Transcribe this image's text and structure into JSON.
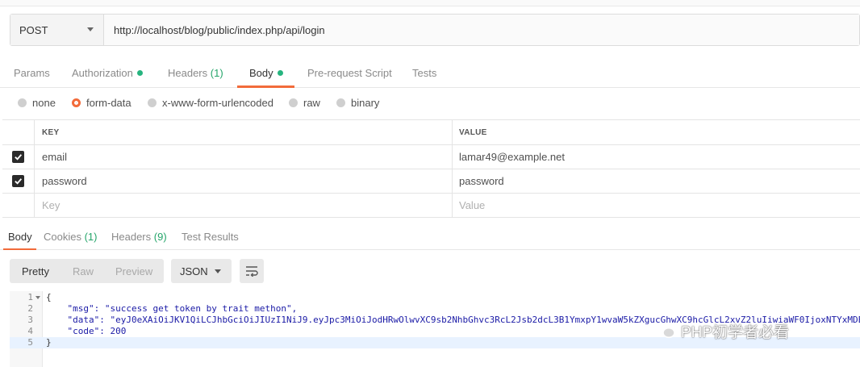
{
  "request": {
    "method": "POST",
    "url": "http://localhost/blog/public/index.php/api/login"
  },
  "request_tabs": [
    {
      "label": "Params"
    },
    {
      "label": "Authorization"
    },
    {
      "label": "Headers",
      "count": "(1)"
    },
    {
      "label": "Body"
    },
    {
      "label": "Pre-request Script"
    },
    {
      "label": "Tests"
    }
  ],
  "body_types": [
    {
      "label": "none"
    },
    {
      "label": "form-data",
      "selected": true
    },
    {
      "label": "x-www-form-urlencoded"
    },
    {
      "label": "raw"
    },
    {
      "label": "binary"
    }
  ],
  "kv_table": {
    "headers": {
      "key": "KEY",
      "value": "VALUE"
    },
    "rows": [
      {
        "key": "email",
        "value": "lamar49@example.net",
        "checked": true
      },
      {
        "key": "password",
        "value": "password",
        "checked": true
      }
    ],
    "placeholder": {
      "key": "Key",
      "value": "Value"
    }
  },
  "response_tabs": [
    {
      "label": "Body"
    },
    {
      "label": "Cookies",
      "count": "(1)"
    },
    {
      "label": "Headers",
      "count": "(9)"
    },
    {
      "label": "Test Results"
    }
  ],
  "view_modes": [
    "Pretty",
    "Raw",
    "Preview"
  ],
  "format": "JSON",
  "code_lines": [
    {
      "n": "1",
      "text": "{"
    },
    {
      "n": "2",
      "text": "    \"msg\": \"success get token by trait methon\","
    },
    {
      "n": "3",
      "text": "    \"data\": \"eyJ0eXAiOiJKV1QiLCJhbGciOiJIUzI1NiJ9.eyJpc3MiOiJodHRwOlwvXC9sb2NhbGhvc3RcL2Jsb2dcL3B1YmxpY1wvaW5kZXgucGhwXC9hcGlcL2xvZ2luIiwiaWF0IjoxNTYxMDE"
    },
    {
      "n": "4",
      "text": "    \"code\": 200"
    },
    {
      "n": "5",
      "text": "}"
    }
  ],
  "watermark": "PHP初学者必看",
  "colors": {
    "accent": "#f26b3a",
    "status_dot": "#26b47f",
    "count": "#25a56a"
  }
}
